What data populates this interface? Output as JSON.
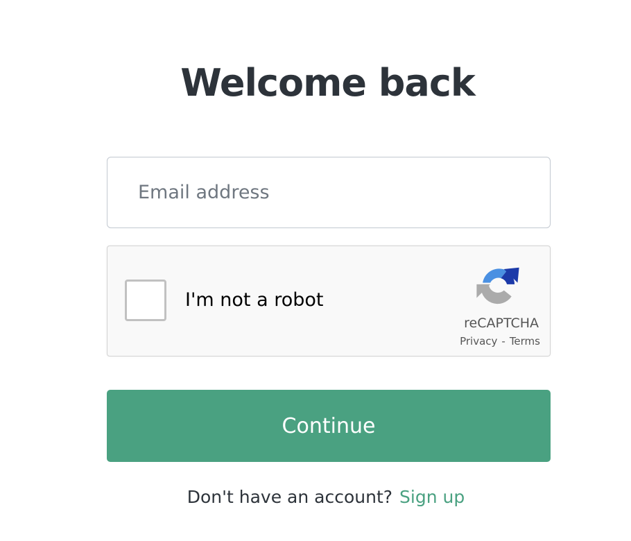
{
  "title": "Welcome back",
  "email": {
    "value": "",
    "placeholder": "Email address"
  },
  "captcha": {
    "checked": false,
    "label": "I'm not a robot",
    "brand": "reCAPTCHA",
    "privacy_link": "Privacy",
    "separator": "-",
    "terms_link": "Terms",
    "logo_icon": "recaptcha-logo-icon"
  },
  "continue_label": "Continue",
  "signup": {
    "prompt": "Don't have an account?",
    "link": "Sign up"
  },
  "colors": {
    "accent": "#4aa181",
    "title": "#2d333a",
    "recaptcha_blue": "#4a90e2",
    "recaptcha_dark_blue": "#1c3aa9",
    "recaptcha_gray": "#ababab"
  }
}
